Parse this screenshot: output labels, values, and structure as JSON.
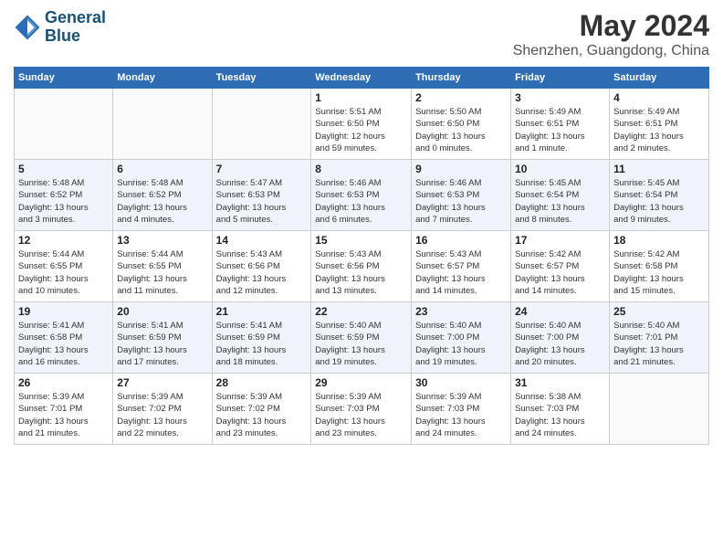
{
  "header": {
    "logo_line1": "General",
    "logo_line2": "Blue",
    "month": "May 2024",
    "location": "Shenzhen, Guangdong, China"
  },
  "weekdays": [
    "Sunday",
    "Monday",
    "Tuesday",
    "Wednesday",
    "Thursday",
    "Friday",
    "Saturday"
  ],
  "weeks": [
    [
      {
        "day": "",
        "info": ""
      },
      {
        "day": "",
        "info": ""
      },
      {
        "day": "",
        "info": ""
      },
      {
        "day": "1",
        "info": "Sunrise: 5:51 AM\nSunset: 6:50 PM\nDaylight: 12 hours\nand 59 minutes."
      },
      {
        "day": "2",
        "info": "Sunrise: 5:50 AM\nSunset: 6:50 PM\nDaylight: 13 hours\nand 0 minutes."
      },
      {
        "day": "3",
        "info": "Sunrise: 5:49 AM\nSunset: 6:51 PM\nDaylight: 13 hours\nand 1 minute."
      },
      {
        "day": "4",
        "info": "Sunrise: 5:49 AM\nSunset: 6:51 PM\nDaylight: 13 hours\nand 2 minutes."
      }
    ],
    [
      {
        "day": "5",
        "info": "Sunrise: 5:48 AM\nSunset: 6:52 PM\nDaylight: 13 hours\nand 3 minutes."
      },
      {
        "day": "6",
        "info": "Sunrise: 5:48 AM\nSunset: 6:52 PM\nDaylight: 13 hours\nand 4 minutes."
      },
      {
        "day": "7",
        "info": "Sunrise: 5:47 AM\nSunset: 6:53 PM\nDaylight: 13 hours\nand 5 minutes."
      },
      {
        "day": "8",
        "info": "Sunrise: 5:46 AM\nSunset: 6:53 PM\nDaylight: 13 hours\nand 6 minutes."
      },
      {
        "day": "9",
        "info": "Sunrise: 5:46 AM\nSunset: 6:53 PM\nDaylight: 13 hours\nand 7 minutes."
      },
      {
        "day": "10",
        "info": "Sunrise: 5:45 AM\nSunset: 6:54 PM\nDaylight: 13 hours\nand 8 minutes."
      },
      {
        "day": "11",
        "info": "Sunrise: 5:45 AM\nSunset: 6:54 PM\nDaylight: 13 hours\nand 9 minutes."
      }
    ],
    [
      {
        "day": "12",
        "info": "Sunrise: 5:44 AM\nSunset: 6:55 PM\nDaylight: 13 hours\nand 10 minutes."
      },
      {
        "day": "13",
        "info": "Sunrise: 5:44 AM\nSunset: 6:55 PM\nDaylight: 13 hours\nand 11 minutes."
      },
      {
        "day": "14",
        "info": "Sunrise: 5:43 AM\nSunset: 6:56 PM\nDaylight: 13 hours\nand 12 minutes."
      },
      {
        "day": "15",
        "info": "Sunrise: 5:43 AM\nSunset: 6:56 PM\nDaylight: 13 hours\nand 13 minutes."
      },
      {
        "day": "16",
        "info": "Sunrise: 5:43 AM\nSunset: 6:57 PM\nDaylight: 13 hours\nand 14 minutes."
      },
      {
        "day": "17",
        "info": "Sunrise: 5:42 AM\nSunset: 6:57 PM\nDaylight: 13 hours\nand 14 minutes."
      },
      {
        "day": "18",
        "info": "Sunrise: 5:42 AM\nSunset: 6:58 PM\nDaylight: 13 hours\nand 15 minutes."
      }
    ],
    [
      {
        "day": "19",
        "info": "Sunrise: 5:41 AM\nSunset: 6:58 PM\nDaylight: 13 hours\nand 16 minutes."
      },
      {
        "day": "20",
        "info": "Sunrise: 5:41 AM\nSunset: 6:59 PM\nDaylight: 13 hours\nand 17 minutes."
      },
      {
        "day": "21",
        "info": "Sunrise: 5:41 AM\nSunset: 6:59 PM\nDaylight: 13 hours\nand 18 minutes."
      },
      {
        "day": "22",
        "info": "Sunrise: 5:40 AM\nSunset: 6:59 PM\nDaylight: 13 hours\nand 19 minutes."
      },
      {
        "day": "23",
        "info": "Sunrise: 5:40 AM\nSunset: 7:00 PM\nDaylight: 13 hours\nand 19 minutes."
      },
      {
        "day": "24",
        "info": "Sunrise: 5:40 AM\nSunset: 7:00 PM\nDaylight: 13 hours\nand 20 minutes."
      },
      {
        "day": "25",
        "info": "Sunrise: 5:40 AM\nSunset: 7:01 PM\nDaylight: 13 hours\nand 21 minutes."
      }
    ],
    [
      {
        "day": "26",
        "info": "Sunrise: 5:39 AM\nSunset: 7:01 PM\nDaylight: 13 hours\nand 21 minutes."
      },
      {
        "day": "27",
        "info": "Sunrise: 5:39 AM\nSunset: 7:02 PM\nDaylight: 13 hours\nand 22 minutes."
      },
      {
        "day": "28",
        "info": "Sunrise: 5:39 AM\nSunset: 7:02 PM\nDaylight: 13 hours\nand 23 minutes."
      },
      {
        "day": "29",
        "info": "Sunrise: 5:39 AM\nSunset: 7:03 PM\nDaylight: 13 hours\nand 23 minutes."
      },
      {
        "day": "30",
        "info": "Sunrise: 5:39 AM\nSunset: 7:03 PM\nDaylight: 13 hours\nand 24 minutes."
      },
      {
        "day": "31",
        "info": "Sunrise: 5:38 AM\nSunset: 7:03 PM\nDaylight: 13 hours\nand 24 minutes."
      },
      {
        "day": "",
        "info": ""
      }
    ]
  ]
}
